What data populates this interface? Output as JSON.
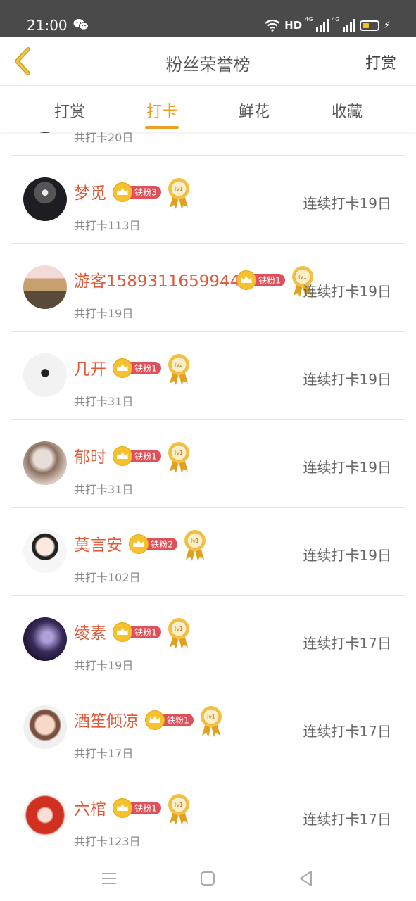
{
  "status_bar": {
    "time": "21:00",
    "hd": "HD",
    "net1": "4G",
    "net2": "4G"
  },
  "header": {
    "title": "粉丝荣誉榜",
    "right_action": "打赏"
  },
  "tabs": [
    {
      "label": "打赏"
    },
    {
      "label": "打卡",
      "active": true
    },
    {
      "label": "鲜花"
    },
    {
      "label": "收藏"
    }
  ],
  "list": {
    "partial_row": {
      "total": "共打卡20日"
    },
    "rows": [
      {
        "name": "梦觅",
        "badge": "铁粉3",
        "medal": "lv1",
        "total": "共打卡113日",
        "streak": "连续打卡19日"
      },
      {
        "name": "游客1589311659944",
        "badge": "铁粉1",
        "medal": "lv1",
        "total": "共打卡19日",
        "streak": "连续打卡19日"
      },
      {
        "name": "几开",
        "badge": "铁粉1",
        "medal": "lv2",
        "total": "共打卡31日",
        "streak": "连续打卡19日"
      },
      {
        "name": "郁时",
        "badge": "铁粉1",
        "medal": "lv1",
        "total": "共打卡31日",
        "streak": "连续打卡19日"
      },
      {
        "name": "莫言安",
        "badge": "铁粉2",
        "medal": "lv1",
        "total": "共打卡102日",
        "streak": "连续打卡19日"
      },
      {
        "name": "绫素",
        "badge": "铁粉1",
        "medal": "lv1",
        "total": "共打卡19日",
        "streak": "连续打卡17日"
      },
      {
        "name": "酒笙倾凉",
        "badge": "铁粉1",
        "medal": "lv1",
        "total": "共打卡17日",
        "streak": "连续打卡17日"
      },
      {
        "name": "六棺",
        "badge": "铁粉1",
        "medal": "lv1",
        "total": "共打卡123日",
        "streak": "连续打卡17日"
      }
    ]
  },
  "colors": {
    "accent": "#f0a020",
    "name": "#e05a3a",
    "badge_red": "#e0505a",
    "crown_gold": "#f5c12e"
  },
  "icons": {
    "back": "chevron-left-icon",
    "wechat": "wechat-icon",
    "wifi": "wifi-icon",
    "battery": "battery-icon",
    "crown": "crown-icon",
    "medal": "medal-icon",
    "nav_menu": "menu-icon",
    "nav_home": "home-icon",
    "nav_back": "back-triangle-icon"
  }
}
